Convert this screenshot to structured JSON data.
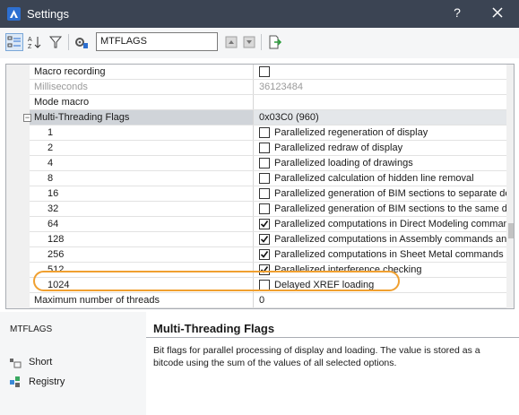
{
  "window": {
    "title": "Settings",
    "help_label": "?"
  },
  "toolbar": {
    "search_value": "MTFLAGS"
  },
  "grid": {
    "rows": [
      {
        "name": "Macro recording",
        "value": "",
        "type": "checkbox",
        "checked": false
      },
      {
        "name": "Milliseconds",
        "value": "36123484",
        "type": "text",
        "disabled": true
      },
      {
        "name": "Mode macro",
        "value": "",
        "type": "text"
      },
      {
        "name": "Multi-Threading Flags",
        "value": "0x03C0 (960)",
        "type": "group"
      }
    ],
    "flags": [
      {
        "bit": "1",
        "label": "Parallelized regeneration of display",
        "checked": false
      },
      {
        "bit": "2",
        "label": "Parallelized redraw of display",
        "checked": false
      },
      {
        "bit": "4",
        "label": "Parallelized loading of drawings",
        "checked": false
      },
      {
        "bit": "8",
        "label": "Parallelized calculation of hidden line removal",
        "checked": false
      },
      {
        "bit": "16",
        "label": "Parallelized generation of BIM sections to separate des",
        "checked": false
      },
      {
        "bit": "32",
        "label": "Parallelized generation of BIM sections to the same de",
        "checked": false
      },
      {
        "bit": "64",
        "label": "Parallelized computations in Direct Modeling command",
        "checked": true
      },
      {
        "bit": "128",
        "label": "Parallelized computations in Assembly commands and",
        "checked": true
      },
      {
        "bit": "256",
        "label": "Parallelized computations in Sheet Metal commands ar",
        "checked": true
      },
      {
        "bit": "512",
        "label": "Parallelized interference checking",
        "checked": true
      },
      {
        "bit": "1024",
        "label": "Delayed XREF loading",
        "checked": false
      }
    ],
    "after": [
      {
        "name": "Maximum number of threads",
        "value": "0"
      }
    ]
  },
  "details": {
    "command": "MTFLAGS",
    "options": [
      "Short",
      "Registry"
    ],
    "title": "Multi-Threading Flags",
    "description": "Bit flags for parallel processing of display and loading. The value is stored as a bitcode using the sum of the values of all selected options."
  },
  "colors": {
    "titlebar": "#3b4453",
    "highlight": "#f0a030",
    "accent": "#2d6fd0"
  }
}
